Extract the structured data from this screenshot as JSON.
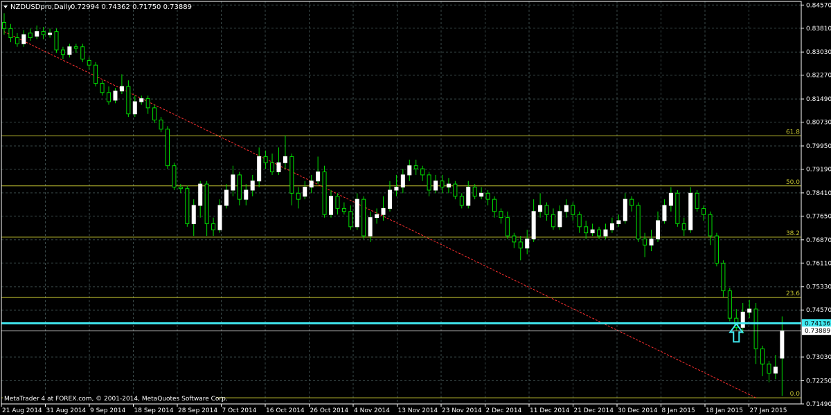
{
  "window": {
    "symbol_title": "NZDUSDpro,Daily",
    "ohlc": "0.72994 0.74362 0.71750 0.73889",
    "footer": "MetaTrader 4 at FOREX.com, © 2001-2014, MetaQuotes Software Corp."
  },
  "colors": {
    "background": "#000000",
    "grid": "#3a4a4a",
    "candle_bull": "#ffffff",
    "candle_bear": "#000000",
    "candle_wick": "#00e000",
    "fib_lines": "#c8c832",
    "trend_line": "#ff3030",
    "support_line": "#40e8f0",
    "arrow": "#40e8f0",
    "axis_text": "#ffffff",
    "price_badge_bg": "#ffffff"
  },
  "chart_data": {
    "type": "candlestick",
    "y_range": [
      0.7149,
      0.8469
    ],
    "price_ticks": [
      "0.84570",
      "0.83810",
      "0.83030",
      "0.82270",
      "0.81490",
      "0.80730",
      "0.79950",
      "0.79190",
      "0.78410",
      "0.77650",
      "0.76870",
      "0.76110",
      "0.75330",
      "0.74570",
      "0.73030",
      "0.72250",
      "0.71490"
    ],
    "date_labels": [
      "21 Aug 2014",
      "31 Aug 2014",
      "9 Sep 2014",
      "18 Sep 2014",
      "28 Sep 2014",
      "7 Oct 2014",
      "16 Oct 2014",
      "26 Oct 2014",
      "4 Nov 2014",
      "13 Nov 2014",
      "23 Nov 2014",
      "2 Dec 2014",
      "11 Dec 2014",
      "21 Dec 2014",
      "30 Dec 2014",
      "8 Jan 2015",
      "18 Jan 2015",
      "27 Jan 2015"
    ],
    "fibonacci": [
      {
        "label": "61.8",
        "price": 0.8028
      },
      {
        "label": "50.0",
        "price": 0.7864
      },
      {
        "label": "38.2",
        "price": 0.7696
      },
      {
        "label": "23.6",
        "price": 0.7498
      },
      {
        "label": "0.0",
        "price": 0.7169
      }
    ],
    "support_level": {
      "label": "0.74136",
      "price": 0.74136
    },
    "current_price": {
      "label": "0.73889",
      "price": 0.73889
    },
    "trend_line": {
      "start": [
        0,
        0.837
      ],
      "end": [
        115,
        0.7169
      ]
    },
    "arrow_at_index": 112,
    "candles": [
      [
        0.84,
        0.838,
        0.843,
        0.836
      ],
      [
        0.838,
        0.835,
        0.8395,
        0.8335
      ],
      [
        0.835,
        0.833,
        0.8365,
        0.832
      ],
      [
        0.833,
        0.836,
        0.8375,
        0.832
      ],
      [
        0.8365,
        0.835,
        0.838,
        0.834
      ],
      [
        0.8355,
        0.837,
        0.839,
        0.8345
      ],
      [
        0.837,
        0.836,
        0.8385,
        0.8345
      ],
      [
        0.836,
        0.8365,
        0.838,
        0.835
      ],
      [
        0.837,
        0.831,
        0.838,
        0.83
      ],
      [
        0.831,
        0.8295,
        0.832,
        0.828
      ],
      [
        0.8295,
        0.832,
        0.833,
        0.8285
      ],
      [
        0.832,
        0.8315,
        0.833,
        0.83
      ],
      [
        0.832,
        0.828,
        0.833,
        0.827
      ],
      [
        0.8275,
        0.826,
        0.8285,
        0.8245
      ],
      [
        0.826,
        0.82,
        0.827,
        0.819
      ],
      [
        0.82,
        0.817,
        0.821,
        0.816
      ],
      [
        0.817,
        0.814,
        0.819,
        0.813
      ],
      [
        0.8145,
        0.8175,
        0.8185,
        0.8135
      ],
      [
        0.8175,
        0.819,
        0.823,
        0.8165
      ],
      [
        0.819,
        0.81,
        0.821,
        0.809
      ],
      [
        0.81,
        0.814,
        0.816,
        0.809
      ],
      [
        0.814,
        0.815,
        0.816,
        0.813
      ],
      [
        0.815,
        0.812,
        0.816,
        0.81
      ],
      [
        0.812,
        0.808,
        0.813,
        0.807
      ],
      [
        0.808,
        0.805,
        0.809,
        0.804
      ],
      [
        0.805,
        0.793,
        0.806,
        0.792
      ],
      [
        0.793,
        0.786,
        0.794,
        0.785
      ],
      [
        0.786,
        0.7855,
        0.787,
        0.784
      ],
      [
        0.7855,
        0.774,
        0.7865,
        0.773
      ],
      [
        0.774,
        0.78,
        0.782,
        0.77
      ],
      [
        0.78,
        0.787,
        0.788,
        0.776
      ],
      [
        0.787,
        0.774,
        0.788,
        0.77
      ],
      [
        0.774,
        0.772,
        0.776,
        0.77
      ],
      [
        0.772,
        0.78,
        0.782,
        0.771
      ],
      [
        0.78,
        0.785,
        0.787,
        0.779
      ],
      [
        0.785,
        0.79,
        0.793,
        0.783
      ],
      [
        0.79,
        0.782,
        0.791,
        0.78
      ],
      [
        0.782,
        0.785,
        0.787,
        0.78
      ],
      [
        0.785,
        0.788,
        0.79,
        0.783
      ],
      [
        0.788,
        0.796,
        0.799,
        0.786
      ],
      [
        0.796,
        0.794,
        0.798,
        0.792
      ],
      [
        0.794,
        0.791,
        0.797,
        0.79
      ],
      [
        0.791,
        0.794,
        0.799,
        0.79
      ],
      [
        0.794,
        0.796,
        0.803,
        0.792
      ],
      [
        0.796,
        0.784,
        0.797,
        0.78
      ],
      [
        0.784,
        0.782,
        0.786,
        0.779
      ],
      [
        0.783,
        0.786,
        0.788,
        0.782
      ],
      [
        0.786,
        0.788,
        0.79,
        0.784
      ],
      [
        0.788,
        0.791,
        0.796,
        0.787
      ],
      [
        0.791,
        0.777,
        0.793,
        0.776
      ],
      [
        0.777,
        0.783,
        0.785,
        0.776
      ],
      [
        0.783,
        0.779,
        0.784,
        0.777
      ],
      [
        0.779,
        0.778,
        0.781,
        0.777
      ],
      [
        0.778,
        0.773,
        0.78,
        0.772
      ],
      [
        0.773,
        0.782,
        0.784,
        0.772
      ],
      [
        0.782,
        0.77,
        0.783,
        0.769
      ],
      [
        0.77,
        0.776,
        0.778,
        0.768
      ],
      [
        0.776,
        0.777,
        0.779,
        0.774
      ],
      [
        0.777,
        0.779,
        0.783,
        0.775
      ],
      [
        0.779,
        0.785,
        0.788,
        0.778
      ],
      [
        0.785,
        0.786,
        0.79,
        0.783
      ],
      [
        0.786,
        0.79,
        0.792,
        0.784
      ],
      [
        0.79,
        0.793,
        0.795,
        0.788
      ],
      [
        0.793,
        0.792,
        0.795,
        0.79
      ],
      [
        0.792,
        0.79,
        0.793,
        0.788
      ],
      [
        0.79,
        0.785,
        0.791,
        0.783
      ],
      [
        0.785,
        0.788,
        0.79,
        0.784
      ],
      [
        0.788,
        0.786,
        0.79,
        0.784
      ],
      [
        0.786,
        0.787,
        0.789,
        0.784
      ],
      [
        0.787,
        0.783,
        0.788,
        0.782
      ],
      [
        0.783,
        0.78,
        0.784,
        0.779
      ],
      [
        0.78,
        0.786,
        0.788,
        0.779
      ],
      [
        0.786,
        0.783,
        0.787,
        0.782
      ],
      [
        0.783,
        0.784,
        0.786,
        0.782
      ],
      [
        0.784,
        0.782,
        0.785,
        0.78
      ],
      [
        0.782,
        0.778,
        0.783,
        0.776
      ],
      [
        0.778,
        0.776,
        0.779,
        0.774
      ],
      [
        0.776,
        0.77,
        0.778,
        0.769
      ],
      [
        0.77,
        0.768,
        0.771,
        0.766
      ],
      [
        0.768,
        0.766,
        0.77,
        0.762
      ],
      [
        0.766,
        0.769,
        0.772,
        0.764
      ],
      [
        0.769,
        0.778,
        0.782,
        0.768
      ],
      [
        0.778,
        0.78,
        0.784,
        0.776
      ],
      [
        0.78,
        0.777,
        0.781,
        0.775
      ],
      [
        0.777,
        0.773,
        0.779,
        0.772
      ],
      [
        0.773,
        0.778,
        0.78,
        0.772
      ],
      [
        0.778,
        0.78,
        0.782,
        0.776
      ],
      [
        0.78,
        0.777,
        0.781,
        0.775
      ],
      [
        0.777,
        0.773,
        0.778,
        0.771
      ],
      [
        0.773,
        0.771,
        0.775,
        0.769
      ],
      [
        0.771,
        0.772,
        0.774,
        0.77
      ],
      [
        0.772,
        0.77,
        0.773,
        0.769
      ],
      [
        0.77,
        0.772,
        0.774,
        0.769
      ],
      [
        0.772,
        0.774,
        0.776,
        0.771
      ],
      [
        0.774,
        0.775,
        0.777,
        0.773
      ],
      [
        0.775,
        0.782,
        0.784,
        0.774
      ],
      [
        0.782,
        0.78,
        0.783,
        0.778
      ],
      [
        0.78,
        0.769,
        0.781,
        0.768
      ],
      [
        0.769,
        0.767,
        0.771,
        0.763
      ],
      [
        0.767,
        0.769,
        0.772,
        0.765
      ],
      [
        0.769,
        0.775,
        0.778,
        0.768
      ],
      [
        0.775,
        0.78,
        0.782,
        0.774
      ],
      [
        0.78,
        0.784,
        0.786,
        0.778
      ],
      [
        0.784,
        0.774,
        0.785,
        0.773
      ],
      [
        0.774,
        0.772,
        0.776,
        0.77
      ],
      [
        0.772,
        0.784,
        0.786,
        0.771
      ],
      [
        0.784,
        0.779,
        0.785,
        0.778
      ],
      [
        0.779,
        0.777,
        0.78,
        0.775
      ],
      [
        0.777,
        0.77,
        0.778,
        0.767
      ],
      [
        0.77,
        0.761,
        0.771,
        0.76
      ],
      [
        0.761,
        0.752,
        0.762,
        0.75
      ],
      [
        0.752,
        0.743,
        0.753,
        0.742
      ],
      [
        0.743,
        0.74,
        0.746,
        0.739
      ],
      [
        0.74,
        0.745,
        0.748,
        0.738
      ],
      [
        0.745,
        0.746,
        0.749,
        0.743
      ],
      [
        0.746,
        0.733,
        0.748,
        0.728
      ],
      [
        0.733,
        0.728,
        0.734,
        0.724
      ],
      [
        0.728,
        0.725,
        0.729,
        0.722
      ],
      [
        0.725,
        0.727,
        0.731,
        0.723
      ],
      [
        0.7299,
        0.7389,
        0.7436,
        0.7175
      ]
    ]
  }
}
